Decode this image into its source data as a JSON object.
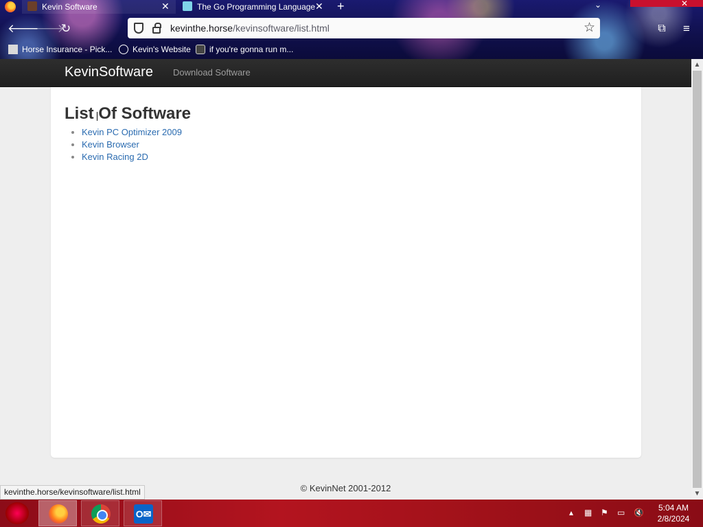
{
  "browser": {
    "tabs": [
      {
        "title": "Kevin Software",
        "active": true
      },
      {
        "title": "The Go Programming Language",
        "active": false
      }
    ],
    "url_host": "kevinthe.horse",
    "url_path": "/kevinsoftware/list.html",
    "bookmarks": [
      {
        "label": "Horse Insurance - Pick..."
      },
      {
        "label": "Kevin's Website"
      },
      {
        "label": "if you're gonna run m..."
      }
    ],
    "status_url": "kevinthe.horse/kevinsoftware/list.html"
  },
  "site": {
    "brand": "KevinSoftware",
    "nav_link": "Download Software",
    "heading": "List Of Software",
    "items": [
      {
        "label": "Kevin PC Optimizer 2009"
      },
      {
        "label": "Kevin Browser"
      },
      {
        "label": "Kevin Racing 2D"
      }
    ],
    "footer": "© KevinNet 2001-2012"
  },
  "taskbar": {
    "apps": [
      "firefox-icon",
      "chrome-icon",
      "outlook-icon"
    ],
    "outlook_glyph": "O✉",
    "time": "5:04 AM",
    "date": "2/8/2024"
  },
  "icons": {
    "back": "🡐",
    "forward": "🡒",
    "reload": "↻",
    "star": "☆",
    "extensions": "⧉",
    "menu": "≡",
    "close": "✕",
    "new_tab": "+",
    "list_tabs": "⌄",
    "scroll_up": "▲",
    "scroll_down": "▼"
  },
  "colors": {
    "link": "#2a6bb0",
    "site_nav_bg": "#222222",
    "taskbar": "#b3141f"
  }
}
